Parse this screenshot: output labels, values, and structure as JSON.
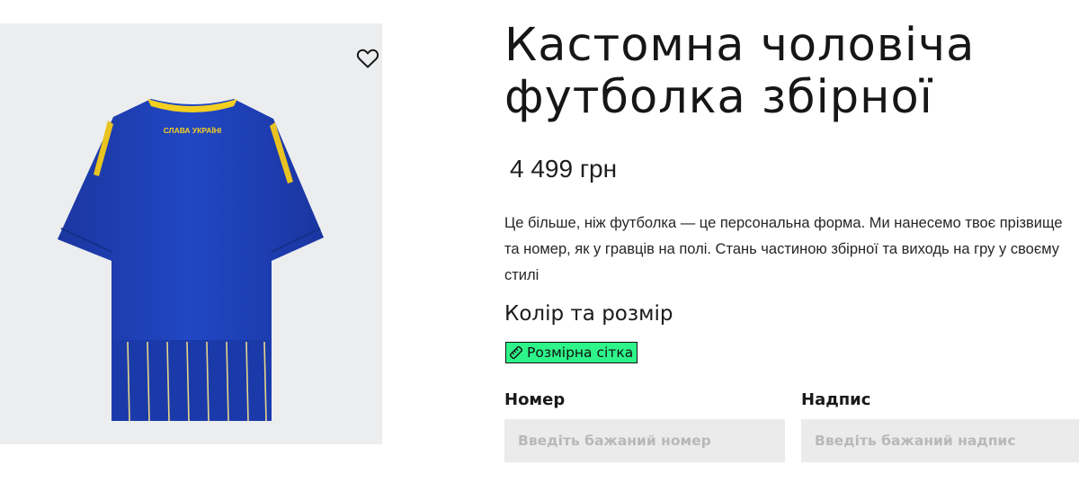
{
  "product": {
    "title_line1": "Кастомна чоловіча",
    "title_line2": "футболка збірної",
    "price": "4 499 грн",
    "description": "Це більше, ніж футболка — це персональна форма. Ми нанесемо твоє прізвище та номер, як у гравців на полі. Стань частиною збірної та виходь на гру у своєму стилі",
    "jersey_text": "СЛАВА УКРАЇНІ"
  },
  "options": {
    "section_title": "Колір та розмір",
    "size_chart_label": "Розмірна сітка"
  },
  "form": {
    "number_label": "Номер",
    "number_placeholder": "Введіть бажаний номер",
    "text_label": "Надпис",
    "text_placeholder": "Введіть бажаний надпис"
  },
  "colors": {
    "accent_green": "#2ef58a",
    "jersey_blue": "#1a3fb0",
    "jersey_yellow": "#f3cf1f"
  },
  "icons": {
    "favorite": "heart-outline-icon",
    "size_chart": "ruler-icon"
  }
}
